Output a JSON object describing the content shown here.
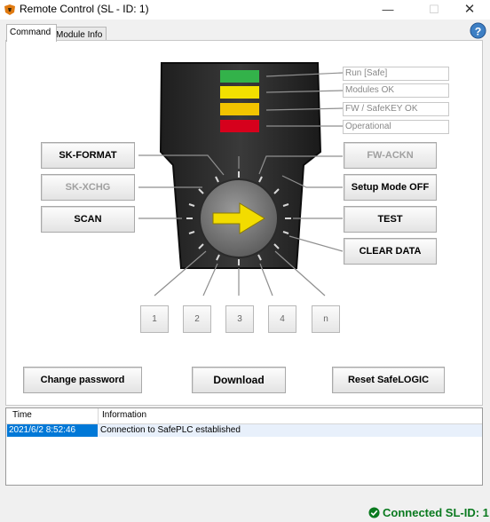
{
  "window": {
    "title": "Remote Control (SL - ID: 1)",
    "minimize": "—",
    "maximize": "☐",
    "close": "✕"
  },
  "tabs": [
    {
      "label": "Command",
      "active": true
    },
    {
      "label": "Module Info",
      "active": false
    }
  ],
  "leds": [
    {
      "label": "Run [Safe]",
      "color": "#33b24a"
    },
    {
      "label": "Modules OK",
      "color": "#f2e000"
    },
    {
      "label": "FW / SafeKEY OK",
      "color": "#f2c400"
    },
    {
      "label": "Operational",
      "color": "#d6001c"
    }
  ],
  "left_buttons": {
    "sk_format": "SK-FORMAT",
    "sk_xchg": "SK-XCHG",
    "scan": "SCAN"
  },
  "right_buttons": {
    "fw_ackn": "FW-ACKN",
    "setup_mode": "Setup Mode OFF",
    "test": "TEST",
    "clear_data": "CLEAR DATA"
  },
  "number_buttons": [
    "1",
    "2",
    "3",
    "4",
    "n"
  ],
  "bottom_buttons": {
    "change_password": "Change password",
    "download": "Download",
    "reset": "Reset SafeLOGIC"
  },
  "log": {
    "columns": [
      "Time",
      "Information"
    ],
    "rows": [
      {
        "time": "2021/6/2 8:52:46",
        "info": "Connection to SafePLC established"
      }
    ]
  },
  "status": {
    "text": "Connected SL-ID: 1",
    "color": "#0a7a1f"
  }
}
